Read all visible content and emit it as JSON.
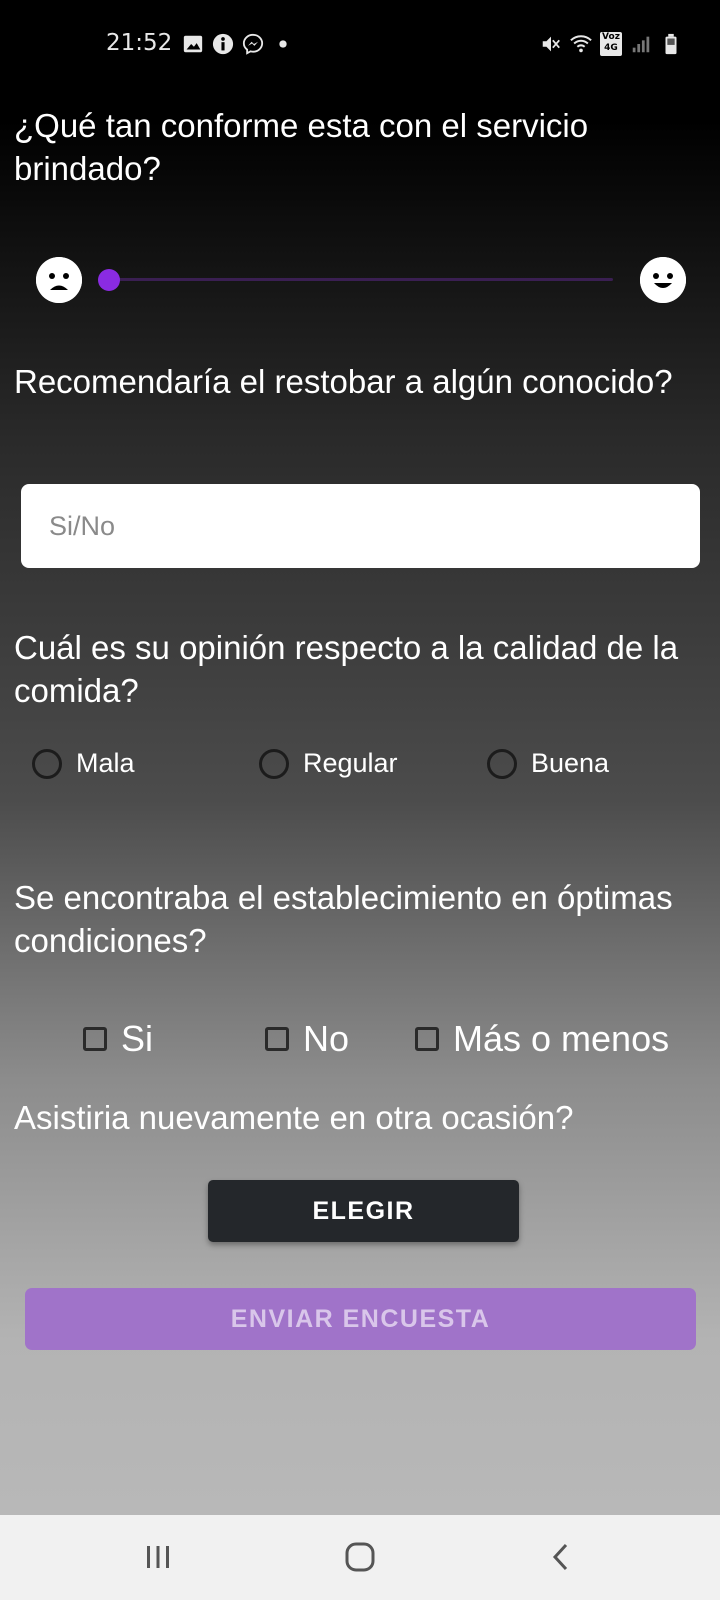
{
  "status_bar": {
    "time": "21:52",
    "left_icons": [
      "image-icon",
      "info-icon",
      "messenger-icon",
      "dot-icon"
    ],
    "right_icons": [
      "mute-icon",
      "wifi-icon",
      "volte-icon",
      "signal-icon",
      "battery-icon"
    ],
    "volte_text_top": "Voz",
    "volte_text_bottom": "4G"
  },
  "survey": {
    "q1": "¿Qué tan conforme esta con el servicio brindado?",
    "slider": {
      "value": 0,
      "accent": "#8a2be2",
      "left_icon": "sad-face-icon",
      "right_icon": "happy-face-icon"
    },
    "q2": "Recomendaría el restobar a algún conocido?",
    "q2_input": {
      "value": "",
      "placeholder": "Si/No"
    },
    "q3": "Cuál es su opinión respecto a la calidad de la comida?",
    "q3_options": [
      "Mala",
      "Regular",
      "Buena"
    ],
    "q4": "Se encontraba el establecimiento en óptimas condiciones?",
    "q4_options": [
      "Si",
      "No",
      "Más o menos"
    ],
    "q5": "Asistiria nuevamente en otra ocasión?",
    "choose_button": "ELEGIR",
    "submit_button": "ENVIAR ENCUESTA",
    "submit_color": "#a073c9"
  },
  "nav_bar": {
    "buttons": [
      "recent-apps-icon",
      "home-icon",
      "back-icon"
    ]
  }
}
